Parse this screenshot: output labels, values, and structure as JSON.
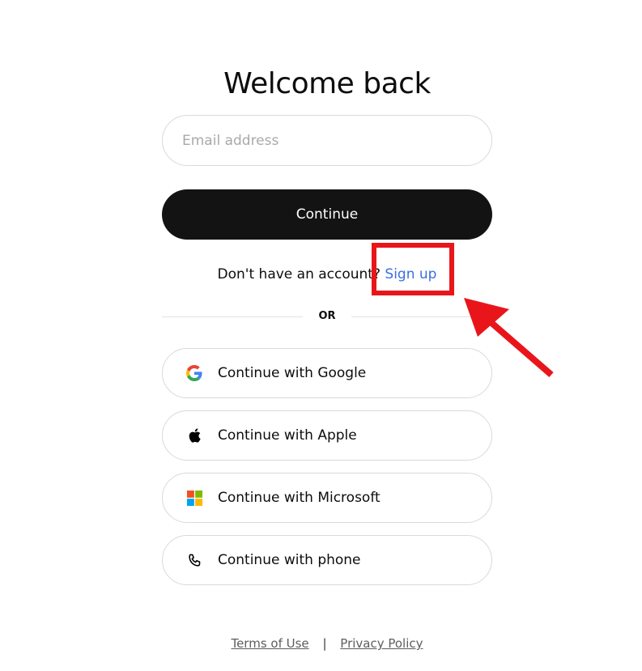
{
  "page": {
    "title": "Welcome back"
  },
  "form": {
    "email_placeholder": "Email address",
    "email_value": "",
    "continue_label": "Continue"
  },
  "signup": {
    "prompt": "Don't have an account?",
    "link_label": "Sign up"
  },
  "divider": {
    "label": "OR"
  },
  "social_buttons": [
    {
      "label": "Continue with Google",
      "icon": "google-icon"
    },
    {
      "label": "Continue with Apple",
      "icon": "apple-icon"
    },
    {
      "label": "Continue with Microsoft",
      "icon": "microsoft-icon"
    },
    {
      "label": "Continue with phone",
      "icon": "phone-icon"
    }
  ],
  "footer": {
    "terms_label": "Terms of Use",
    "separator": "|",
    "privacy_label": "Privacy Policy"
  },
  "colors": {
    "primary_button": "#131313",
    "link": "#3b6fe0",
    "annotation": "#e8161b"
  }
}
